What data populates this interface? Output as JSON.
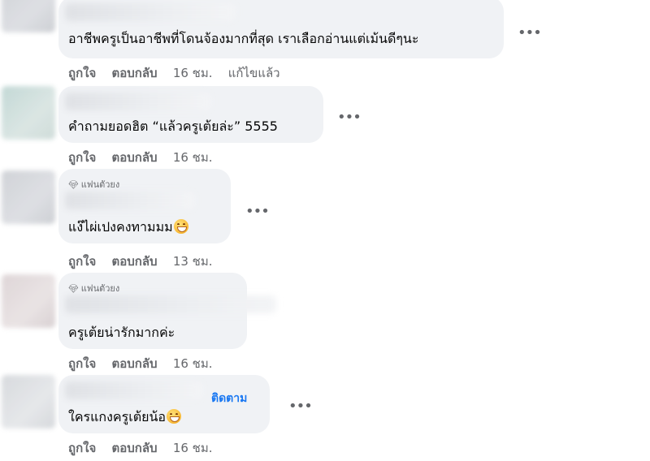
{
  "comments": [
    {
      "text": "อาชีพครูเป็นอาชีพที่โดนจ้องมากที่สุด เราเลือกอ่านแต่เม้นดีๆนะ",
      "like": "ถูกใจ",
      "reply": "ตอบกลับ",
      "time": "16 ชม.",
      "edited": "แก้ไขแล้ว"
    },
    {
      "text": "คำถามยอดฮิต “แล้วครูเต้ยล่ะ” 5555",
      "like": "ถูกใจ",
      "reply": "ตอบกลับ",
      "time": "16 ชม."
    },
    {
      "badge": "แฟนตัวยง",
      "text": "แง๊ไผ่เปงคงทามมม",
      "emoji": "grinning-sweat-emoji",
      "like": "ถูกใจ",
      "reply": "ตอบกลับ",
      "time": "13 ชม."
    },
    {
      "badge": "แฟนตัวยง",
      "text": "ครูเต้ยน่ารักมากค่ะ",
      "like": "ถูกใจ",
      "reply": "ตอบกลับ",
      "time": "16 ชม."
    },
    {
      "follow": "ติดตาม",
      "text": "ใครแกงครูเต้ยน้อ",
      "emoji": "grinning-emoji",
      "like": "ถูกใจ",
      "reply": "ตอบกลับ",
      "time": "16 ชม."
    }
  ],
  "more_glyph": "•••",
  "badge_icon": "diamond-icon",
  "colors": {
    "bubble": "#f0f2f5",
    "link": "#1877f2",
    "meta": "#65676b"
  }
}
